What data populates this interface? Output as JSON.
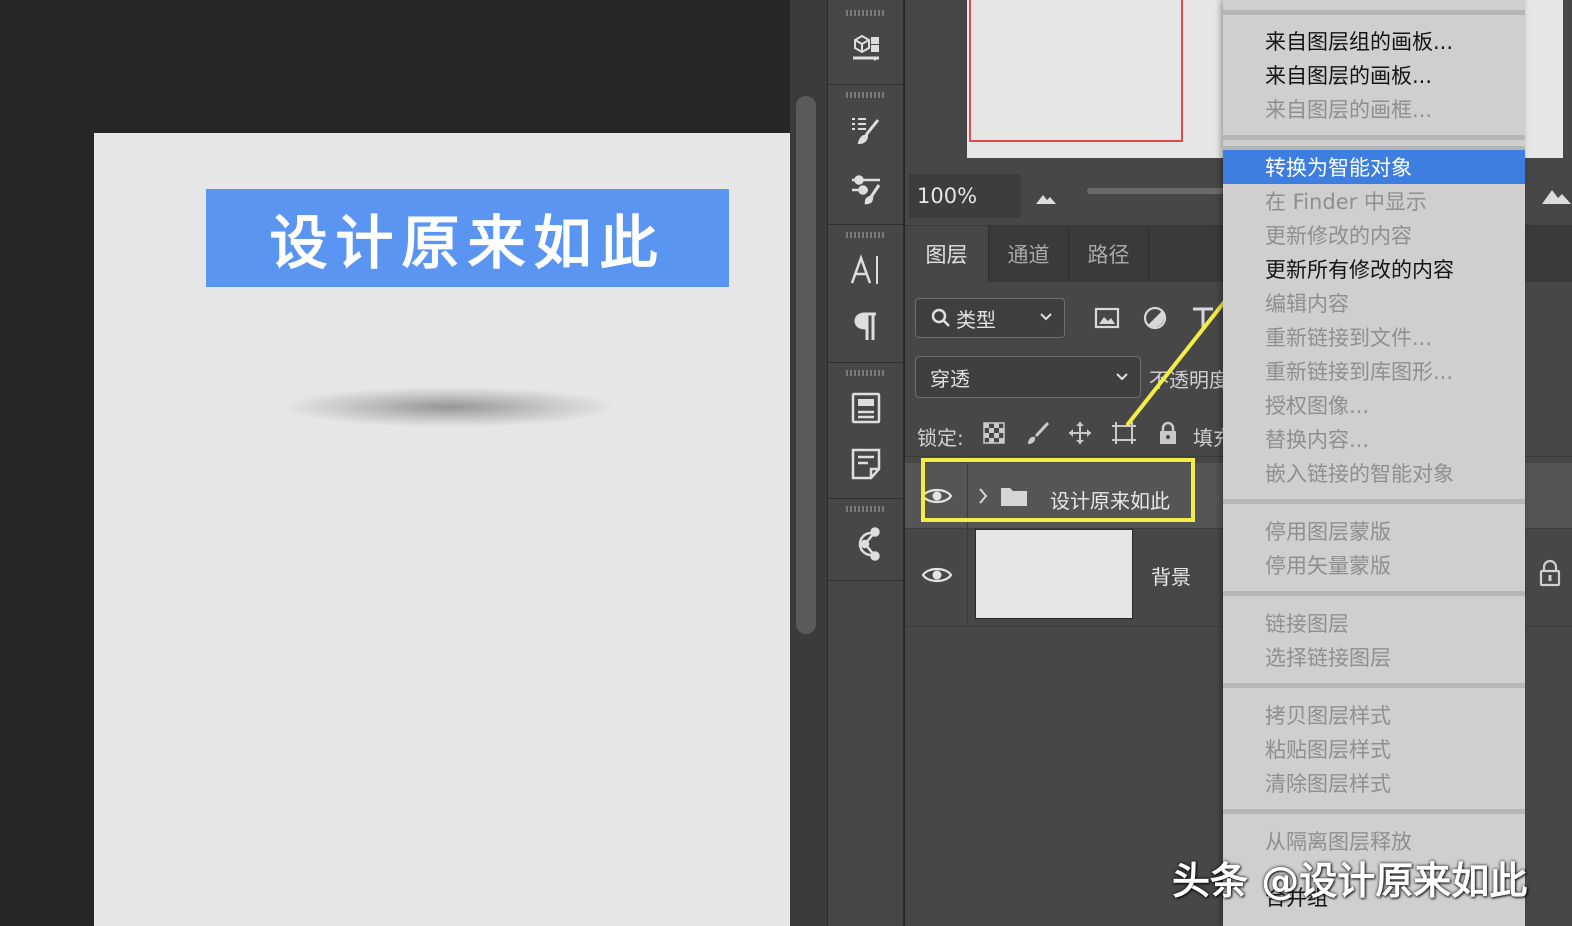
{
  "canvas": {
    "banner_text": "设计原来如此"
  },
  "navigator": {
    "zoom_value": "100%"
  },
  "panel": {
    "tabs": [
      {
        "label": "图层",
        "active": true
      },
      {
        "label": "通道",
        "active": false
      },
      {
        "label": "路径",
        "active": false
      }
    ],
    "filter_kind": "类型",
    "blend_mode": "穿透",
    "opacity_label": "不透明度",
    "lock_label": "锁定:",
    "fill_label": "填充"
  },
  "layers": [
    {
      "name": "设计原来如此",
      "type": "group",
      "visible": true,
      "selected": true
    },
    {
      "name": "背景",
      "type": "pixel",
      "visible": true,
      "locked": true
    }
  ],
  "context_menu": {
    "items": [
      {
        "label": "来自图层组的画板...",
        "enabled": true
      },
      {
        "label": "来自图层的画板...",
        "enabled": true
      },
      {
        "label": "来自图层的画框...",
        "enabled": false
      },
      {
        "label": "转换为智能对象",
        "enabled": true,
        "selected": true
      },
      {
        "label": "在 Finder 中显示",
        "enabled": false
      },
      {
        "label": "更新修改的内容",
        "enabled": false
      },
      {
        "label": "更新所有修改的内容",
        "enabled": true
      },
      {
        "label": "编辑内容",
        "enabled": false
      },
      {
        "label": "重新链接到文件...",
        "enabled": false
      },
      {
        "label": "重新链接到库图形...",
        "enabled": false
      },
      {
        "label": "授权图像...",
        "enabled": false
      },
      {
        "label": "替换内容...",
        "enabled": false
      },
      {
        "label": "嵌入链接的智能对象",
        "enabled": false
      },
      {
        "label": "停用图层蒙版",
        "enabled": false
      },
      {
        "label": "停用矢量蒙版",
        "enabled": false
      },
      {
        "label": "链接图层",
        "enabled": false
      },
      {
        "label": "选择链接图层",
        "enabled": false
      },
      {
        "label": "拷贝图层样式",
        "enabled": false
      },
      {
        "label": "粘贴图层样式",
        "enabled": false
      },
      {
        "label": "清除图层样式",
        "enabled": false
      },
      {
        "label": "从隔离图层释放",
        "enabled": false
      },
      {
        "label": "合并组",
        "enabled": true
      }
    ]
  },
  "annotation": {
    "color": "#f4ec47"
  },
  "watermark": "头条 @设计原来如此",
  "icons": {
    "tools": [
      "3d-cube-icon",
      "brush-presets-icon",
      "adjustments-brush-icon",
      "character-icon",
      "paragraph-icon",
      "properties-icon",
      "notes-icon",
      "paths-connect-icon"
    ],
    "filters": [
      "image-filter-icon",
      "adjustment-filter-icon",
      "type-filter-icon"
    ],
    "locks": [
      "lock-transparent-icon",
      "lock-paint-icon",
      "lock-move-icon",
      "lock-artboard-icon",
      "lock-all-icon"
    ]
  },
  "colors": {
    "banner": "#5b95f2",
    "menu_selected": "#3d7ee0",
    "nav_view_rect": "#e24b4b"
  }
}
